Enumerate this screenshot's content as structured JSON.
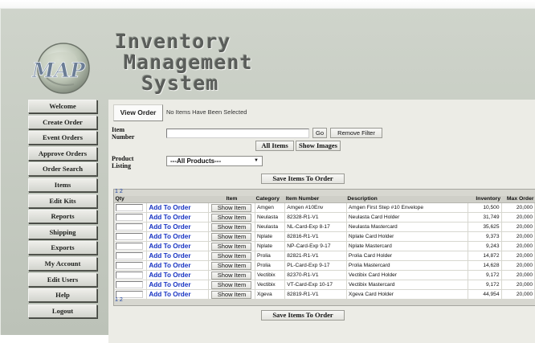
{
  "app": {
    "logo_text": "MAP",
    "title_lines": [
      "Inventory",
      "Management",
      "System"
    ]
  },
  "nav": {
    "items": [
      "Welcome",
      "Create Order",
      "Event Orders",
      "Approve Orders",
      "Order Search",
      "Items",
      "Edit Kits",
      "Reports",
      "Shipping",
      "Exports",
      "My Account",
      "Edit Users",
      "Help",
      "Logout"
    ]
  },
  "order": {
    "view_order_label": "View Order",
    "status_text": "No Items Have Been Selected"
  },
  "filter": {
    "item_number_label_1": "Item",
    "item_number_label_2": "Number",
    "item_number_value": "",
    "go_label": "Go",
    "remove_filter_label": "Remove Filter",
    "all_items_label": "All Items",
    "show_images_label": "Show Images",
    "product_listing_label_1": "Product",
    "product_listing_label_2": "Listing",
    "product_selected": "---All Products---",
    "save_items_label": "Save Items To Order"
  },
  "grid": {
    "pages": [
      "1",
      "2"
    ],
    "headers": {
      "qty": "Qty",
      "item": "Item",
      "category": "Category",
      "item_number": "Item Number",
      "description": "Description",
      "inventory": "Inventory",
      "max_order": "Max Order"
    },
    "add_label": "Add To Order",
    "show_label": "Show Item",
    "rows": [
      {
        "category": "Amgen",
        "item_number": "Amgen #10Env",
        "description": "Amgen First Step #10 Envelope",
        "inventory": "10,500",
        "max_order": "20,000"
      },
      {
        "category": "Neulasta",
        "item_number": "82328-R1-V1",
        "description": "Neulasta Card Holder",
        "inventory": "31,749",
        "max_order": "20,000"
      },
      {
        "category": "Neulasta",
        "item_number": "NL-Card-Exp 8-17",
        "description": "Neulasta Mastercard",
        "inventory": "35,625",
        "max_order": "20,000"
      },
      {
        "category": "Nplate",
        "item_number": "82816-R1-V1",
        "description": "Nplate Card Holder",
        "inventory": "9,373",
        "max_order": "20,000"
      },
      {
        "category": "Nplate",
        "item_number": "NP-Card-Exp 9-17",
        "description": "Nplate Mastercard",
        "inventory": "9,243",
        "max_order": "20,000"
      },
      {
        "category": "Prolia",
        "item_number": "82821-R1-V1",
        "description": "Prolia Card Holder",
        "inventory": "14,872",
        "max_order": "20,000"
      },
      {
        "category": "Prolia",
        "item_number": "PL-Card-Exp 9-17",
        "description": "Prolia Mastercard",
        "inventory": "14,628",
        "max_order": "20,000"
      },
      {
        "category": "Vectibix",
        "item_number": "82370-R1-V1",
        "description": "Vectibix Card Holder",
        "inventory": "9,172",
        "max_order": "20,000"
      },
      {
        "category": "Vectibix",
        "item_number": "VT-Card-Exp 10-17",
        "description": "Vectibix Mastercard",
        "inventory": "9,172",
        "max_order": "20,000"
      },
      {
        "category": "Xgeva",
        "item_number": "82819-R1-V1",
        "description": "Xgeva Card Holder",
        "inventory": "44,954",
        "max_order": "20,000"
      }
    ]
  },
  "bottom": {
    "save_items_label": "Save Items To Order"
  }
}
